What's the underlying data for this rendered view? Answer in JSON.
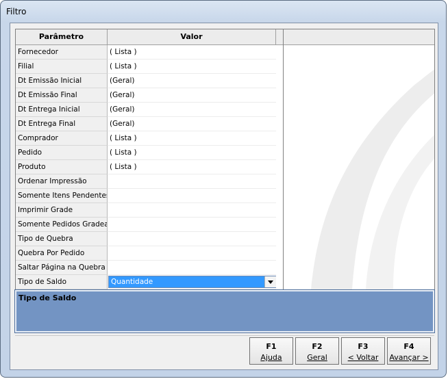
{
  "window": {
    "title": "Filtro"
  },
  "grid": {
    "headers": {
      "parameter": "Parâmetro",
      "value": "Valor"
    },
    "rows": [
      {
        "param": "Fornecedor",
        "value": "( Lista )"
      },
      {
        "param": "Filial",
        "value": "( Lista )"
      },
      {
        "param": "Dt Emissão Inicial",
        "value": "(Geral)"
      },
      {
        "param": "Dt Emissão Final",
        "value": "(Geral)"
      },
      {
        "param": "Dt Entrega Inicial",
        "value": "(Geral)"
      },
      {
        "param": "Dt Entrega Final",
        "value": "(Geral)"
      },
      {
        "param": "Comprador",
        "value": "( Lista )"
      },
      {
        "param": "Pedido",
        "value": "( Lista )"
      },
      {
        "param": "Produto",
        "value": "( Lista )"
      },
      {
        "param": "Ordenar Impressão",
        "value": ""
      },
      {
        "param": "Somente Itens Pendentes",
        "value": ""
      },
      {
        "param": "Imprimir Grade",
        "value": ""
      },
      {
        "param": "Somente Pedidos Gradead",
        "value": ""
      },
      {
        "param": "Tipo de Quebra",
        "value": ""
      },
      {
        "param": "Quebra Por Pedido",
        "value": ""
      },
      {
        "param": "Saltar Página na Quebra",
        "value": ""
      }
    ],
    "selected_row": {
      "param": "Tipo de Saldo",
      "value": "Quantidade"
    }
  },
  "description": {
    "text": "Tipo de Saldo"
  },
  "buttons": [
    {
      "key": "F1",
      "label": "Ajuda"
    },
    {
      "key": "F2",
      "label": "Geral"
    },
    {
      "key": "F3",
      "label": "< Voltar"
    },
    {
      "key": "F4",
      "label": "Avançar >"
    }
  ],
  "colors": {
    "description_bg": "#7394c3",
    "selection": "#3399ff"
  }
}
